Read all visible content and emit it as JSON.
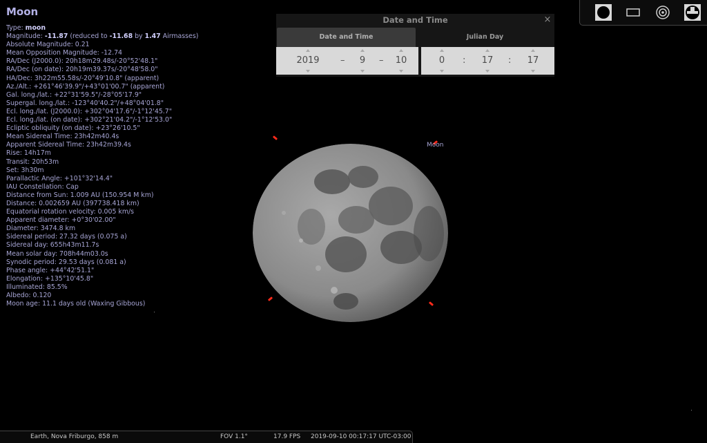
{
  "object": {
    "title": "Moon",
    "lines": [
      [
        "Type: ",
        {
          "b": "moon"
        }
      ],
      [
        "Magnitude: ",
        {
          "b": "-11.87"
        },
        " (reduced to ",
        {
          "b": "-11.68"
        },
        " by ",
        {
          "b": "1.47"
        },
        " Airmasses)"
      ],
      [
        "Absolute Magnitude: 0.21"
      ],
      [
        "Mean Opposition Magnitude: -12.74"
      ],
      [
        "RA/Dec (J2000.0): 20h18m29.48s/-20°52'48.1\""
      ],
      [
        "RA/Dec (on date): 20h19m39.37s/-20°48'58.0\""
      ],
      [
        "HA/Dec: 3h22m55.58s/-20°49'10.8\" (apparent)"
      ],
      [
        "Az./Alt.: +261°46'39.9\"/+43°01'00.7\" (apparent)"
      ],
      [
        "Gal. long./lat.: +22°31'59.5\"/-28°05'17.9\""
      ],
      [
        "Supergal. long./lat.: -123°40'40.2\"/+48°04'01.8\""
      ],
      [
        "Ecl. long./lat. (J2000.0): +302°04'17.6\"/-1°12'45.7\""
      ],
      [
        "Ecl. long./lat. (on date): +302°21'04.2\"/-1°12'53.0\""
      ],
      [
        "Ecliptic obliquity (on date): +23°26'10.5\""
      ],
      [
        "Mean Sidereal Time: 23h42m40.4s"
      ],
      [
        "Apparent Sidereal Time: 23h42m39.4s"
      ],
      [
        "Rise: 14h17m"
      ],
      [
        "Transit: 20h53m"
      ],
      [
        "Set: 3h30m"
      ],
      [
        "Parallactic Angle: +101°32'14.4\""
      ],
      [
        "IAU Constellation: Cap"
      ],
      [
        "Distance from Sun: 1.009 AU (150.954 M km)"
      ],
      [
        "Distance: 0.002659 AU (397738.418 km)"
      ],
      [
        "Equatorial rotation velocity: 0.005 km/s"
      ],
      [
        "Apparent diameter: +0°30'02.00\""
      ],
      [
        "Diameter: 3474.8 km"
      ],
      [
        "Sidereal period: 27.32 days (0.075 a)"
      ],
      [
        "Sidereal day: 655h43m11.7s"
      ],
      [
        "Mean solar day: 708h44m03.0s"
      ],
      [
        "Synodic period: 29.53 days (0.081 a)"
      ],
      [
        "Phase angle: +44°42'51.1\""
      ],
      [
        "Elongation: +135°10'45.8\""
      ],
      [
        "Illuminated: 85.5%"
      ],
      [
        "Albedo: 0.120"
      ],
      [
        "Moon age: 11.1 days old (Waxing Gibbous)"
      ]
    ]
  },
  "sky": {
    "moon_label": "Moon"
  },
  "date_time_window": {
    "title": "Date and Time",
    "close_icon": "×",
    "tabs": [
      "Date and Time",
      "Julian Day"
    ],
    "date": {
      "year": "2019",
      "month": "9",
      "day": "10",
      "separator": "–"
    },
    "time": {
      "hour": "0",
      "minute": "17",
      "second": "17",
      "separator": ":"
    }
  },
  "top_toolbar": {
    "buttons": [
      "moon-filled-icon",
      "rectangle-icon",
      "target-circle-icon",
      "equatorial-mount-icon"
    ]
  },
  "status_bar": {
    "location": "Earth, Nova Friburgo, 858 m",
    "fov": "FOV 1.1°",
    "fps": "17.9 FPS",
    "datetime": "2019-09-10 00:17:17 UTC-03:00"
  },
  "colors": {
    "info_text": "#a8a6d6",
    "selection_marker": "#ff2a1a",
    "background": "#000000"
  }
}
